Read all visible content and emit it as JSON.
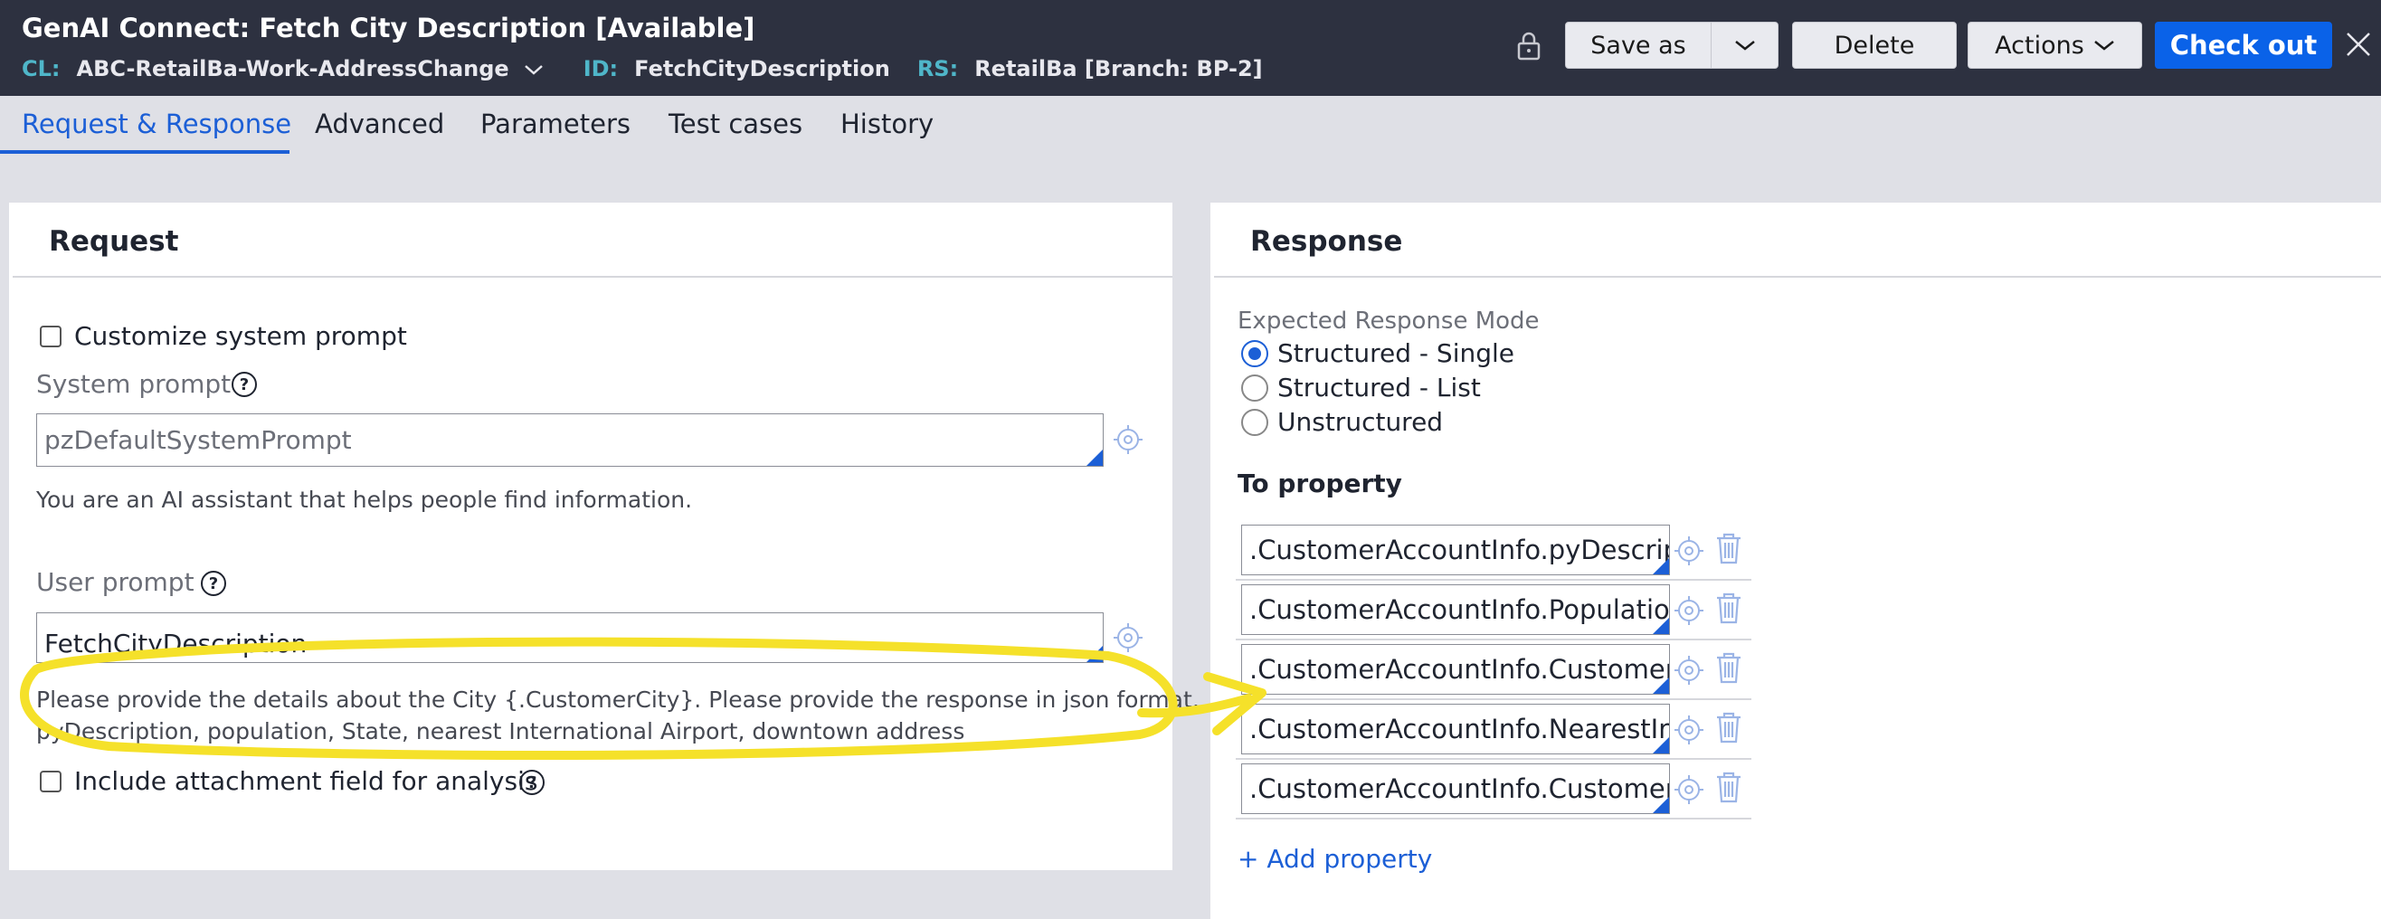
{
  "header": {
    "title": "GenAI Connect: Fetch City Description [Available]",
    "cl_key": "CL:",
    "cl_value": "ABC-RetailBa-Work-AddressChange",
    "id_key": "ID:",
    "id_value": "FetchCityDescription",
    "rs_key": "RS:",
    "rs_value": "RetailBa [Branch: BP-2]",
    "buttons": {
      "save_as": "Save as",
      "delete": "Delete",
      "actions": "Actions",
      "check_out": "Check out"
    }
  },
  "tabs": [
    "Request & Response",
    "Advanced",
    "Parameters",
    "Test cases",
    "History"
  ],
  "request": {
    "title": "Request",
    "customize_label": "Customize system prompt",
    "system_prompt_label": "System prompt",
    "system_prompt_value": "pzDefaultSystemPrompt",
    "system_prompt_text": "You are an AI assistant that helps people find information.",
    "user_prompt_label": "User prompt",
    "user_prompt_value": "FetchCityDescription",
    "user_prompt_text_line1": "Please provide the details about the City {.CustomerCity}. Please provide the response in json format,",
    "user_prompt_text_line2": "pyDescription, population, State, nearest International Airport, downtown address",
    "attachment_label": "Include attachment field for analysis"
  },
  "response": {
    "title": "Response",
    "mode_label": "Expected Response Mode",
    "modes": [
      "Structured - Single",
      "Structured - List",
      "Unstructured"
    ],
    "selected_mode": "Structured - Single",
    "to_property_label": "To property",
    "properties": [
      ".CustomerAccountInfo.pyDescription",
      ".CustomerAccountInfo.Population",
      ".CustomerAccountInfo.CustomerState",
      ".CustomerAccountInfo.NearestInternationalAirport",
      ".CustomerAccountInfo.CustomerAddress"
    ],
    "add_property": "+ Add property"
  },
  "colors": {
    "header_bg": "#2d3140",
    "accent": "#1c5fd6",
    "primary_button": "#0a62e8",
    "annotation": "#f5e12a"
  }
}
